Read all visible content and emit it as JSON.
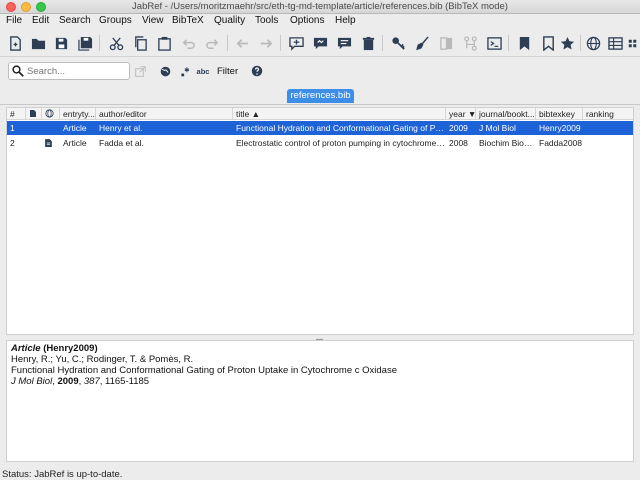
{
  "window": {
    "title": "JabRef - /Users/moritzmaehr/src/eth-tg-md-template/article/references.bib (BibTeX mode)"
  },
  "menu": [
    "File",
    "Edit",
    "Search",
    "Groups",
    "View",
    "BibTeX",
    "Quality",
    "Tools",
    "Options",
    "Help"
  ],
  "toolbar": {
    "icons": [
      "new-library-icon",
      "open-library-icon",
      "save-icon",
      "save-all-icon",
      "cut-icon",
      "copy-icon",
      "paste-icon",
      "undo-icon",
      "redo-icon",
      "back-icon",
      "forward-icon",
      "new-entry-icon",
      "new-entry-from-clipboard-icon",
      "edit-entry-icon",
      "delete-entry-icon",
      "key-icon",
      "cleanup-icon",
      "merge-icon",
      "connect-icon",
      "terminal-icon",
      "mark-icon",
      "bookmark-icon",
      "star-icon",
      "globe-icon",
      "columns-icon"
    ]
  },
  "search": {
    "placeholder": "Search...",
    "filter_label": "Filter"
  },
  "tab": {
    "label": "references.bib"
  },
  "table": {
    "columns": [
      {
        "key": "num",
        "label": "#"
      },
      {
        "key": "file",
        "label": ""
      },
      {
        "key": "url",
        "label": ""
      },
      {
        "key": "entrytype",
        "label": "entryty..."
      },
      {
        "key": "author",
        "label": "author/editor"
      },
      {
        "key": "title",
        "label": "title ▲"
      },
      {
        "key": "year",
        "label": "year ▼"
      },
      {
        "key": "journal",
        "label": "journal/bookt..."
      },
      {
        "key": "bibtexkey",
        "label": "bibtexkey"
      },
      {
        "key": "ranking",
        "label": "ranking"
      }
    ],
    "rows": [
      {
        "num": "1",
        "entrytype": "Article",
        "author": "Henry et al.",
        "title": "Functional Hydration and Conformational Gating of Proton Uptake in Cytochrome c Oxidase",
        "year": "2009",
        "journal": "J Mol Biol",
        "bibtexkey": "Henry2009",
        "has_file": false,
        "selected": true
      },
      {
        "num": "2",
        "entrytype": "Article",
        "author": "Fadda et al.",
        "title": "Electrostatic control of proton pumping in cytochrome c oxidase",
        "year": "2008",
        "journal": "Biochim Biophys Acta",
        "bibtexkey": "Fadda2008",
        "has_file": true,
        "selected": false
      }
    ]
  },
  "preview": {
    "entry_type": "Article",
    "entry_key": "(Henry2009)",
    "authors": "Henry, R.; Yu, C.; Rodinger, T. & Pomès, R.",
    "title": "Functional Hydration and Conformational Gating of Proton Uptake in Cytochrome c Oxidase",
    "journal": "J Mol Biol",
    "year": "2009",
    "volume": "387",
    "pages": "1165-1185"
  },
  "status": {
    "text": "Status: JabRef is up-to-date."
  },
  "colors": {
    "selection": "#1d62d6",
    "tab": "#3c8ee6",
    "icon": "#2d3e55"
  }
}
